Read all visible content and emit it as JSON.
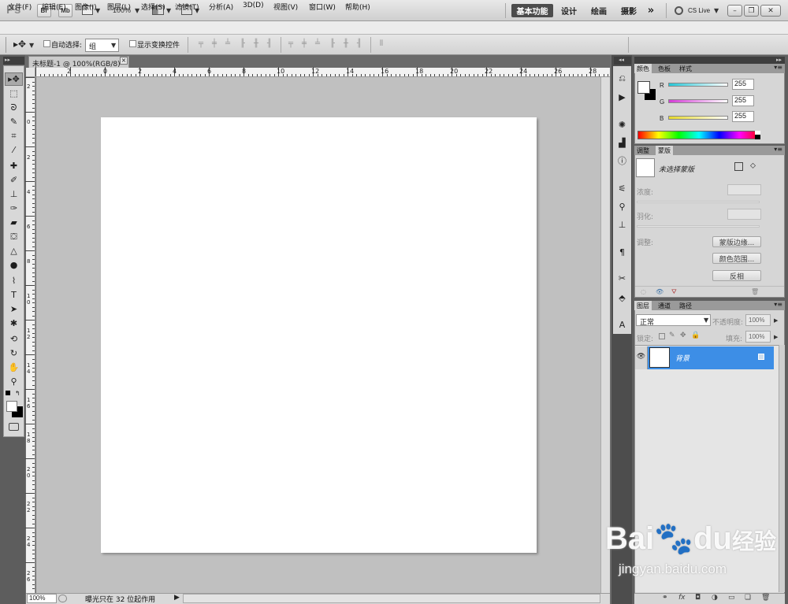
{
  "appbar": {
    "logo": "Ps",
    "bridge_label": "Br",
    "mini_bridge_label": "Mb",
    "zoom": "100%",
    "workspaces": [
      "基本功能",
      "设计",
      "绘画",
      "摄影"
    ],
    "more": "»",
    "cs_live": "CS Live"
  },
  "window_buttons": {
    "minimize": "–",
    "restore": "❐",
    "close": "✕"
  },
  "menu": [
    "文件(F)",
    "编辑(E)",
    "图像(I)",
    "图层(L)",
    "选择(S)",
    "滤镜(T)",
    "分析(A)",
    "3D(D)",
    "视图(V)",
    "窗口(W)",
    "帮助(H)"
  ],
  "options": {
    "auto_select_label": "自动选择:",
    "auto_select_value": "组",
    "show_transform_label": "显示变换控件"
  },
  "document": {
    "tab_title": "未标题-1 @ 100%(RGB/8)",
    "ruler_h": [
      "2",
      "0",
      "2",
      "4",
      "6",
      "8",
      "10",
      "12",
      "14",
      "16",
      "18",
      "20",
      "22",
      "24",
      "26",
      "28"
    ],
    "ruler_v": [
      "2",
      "0",
      "2",
      "4",
      "6",
      "8",
      "10",
      "12",
      "14",
      "16",
      "18",
      "20",
      "22",
      "24",
      "26"
    ],
    "zoom_field": "100%",
    "status_text": "曝光只在 32 位起作用"
  },
  "color_panel": {
    "tabs": [
      "颜色",
      "色板",
      "样式"
    ],
    "channels": [
      {
        "label": "R",
        "value": "255",
        "color": "#26c6d6"
      },
      {
        "label": "G",
        "value": "255",
        "color": "#d43ad6"
      },
      {
        "label": "B",
        "value": "255",
        "color": "#e6d92a"
      }
    ]
  },
  "masks_panel": {
    "tabs": [
      "调整",
      "蒙版"
    ],
    "no_mask": "未选择蒙版",
    "density": "浓度:",
    "feather": "羽化:",
    "refine": "调整:",
    "mask_edge": "蒙版边缘...",
    "color_range": "颜色范围...",
    "invert": "反相"
  },
  "layers_panel": {
    "tabs": [
      "图层",
      "通道",
      "路径"
    ],
    "blend_mode": "正常",
    "opacity_label": "不透明度:",
    "opacity_value": "100%",
    "lock_label": "锁定:",
    "fill_label": "填充:",
    "fill_value": "100%",
    "layer_name": "背景"
  },
  "watermark": {
    "brand": "Bai",
    "brand2": "du",
    "suffix": "经验",
    "url": "jingyan.baidu.com"
  },
  "colors": {
    "selected_layer": "#3d8ee6",
    "workspace_active": "#4c4c4c"
  }
}
